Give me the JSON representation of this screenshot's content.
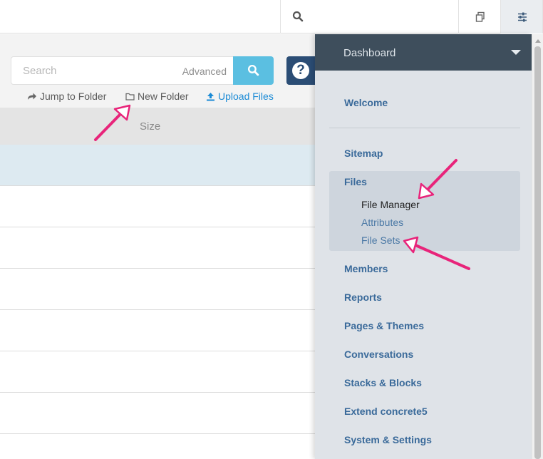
{
  "main": {
    "search": {
      "placeholder": "Search",
      "advanced_label": "Advanced"
    },
    "actions": {
      "jump_to_folder": "Jump to Folder",
      "new_folder": "New Folder",
      "upload_files": "Upload Files"
    },
    "table": {
      "size_header": "Size"
    }
  },
  "panel": {
    "title": "Dashboard",
    "items": {
      "welcome": "Welcome",
      "sitemap": "Sitemap",
      "files": "Files",
      "file_manager": "File Manager",
      "attributes": "Attributes",
      "file_sets": "File Sets",
      "members": "Members",
      "reports": "Reports",
      "pages_themes": "Pages & Themes",
      "conversations": "Conversations",
      "stacks_blocks": "Stacks & Blocks",
      "extend": "Extend concrete5",
      "system_settings": "System & Settings"
    }
  },
  "colors": {
    "accent_blue": "#5bbfe1",
    "help_navy": "#2b4d75",
    "nav_link": "#3a6a9a",
    "annotation_pink": "#e8247a"
  },
  "icons": {
    "top_search": "search-icon",
    "copy": "copy-icon",
    "settings": "sliders-icon",
    "jump": "share-arrow-icon",
    "folder": "folder-icon",
    "upload": "upload-icon",
    "help": "question-circle-icon"
  }
}
